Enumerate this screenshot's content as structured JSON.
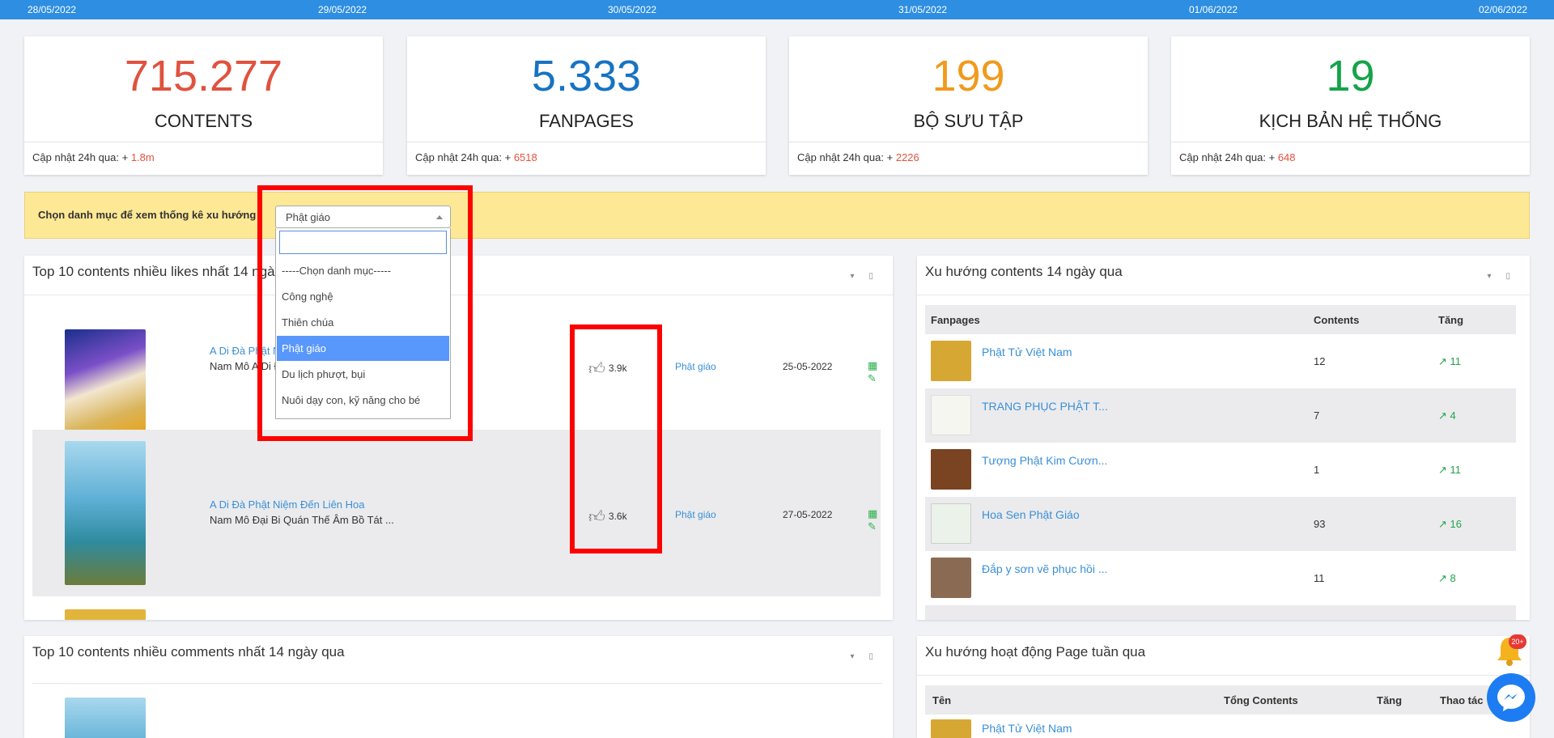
{
  "dates": [
    "28/05/2022",
    "29/05/2022",
    "30/05/2022",
    "31/05/2022",
    "01/06/2022",
    "02/06/2022"
  ],
  "stats": [
    {
      "value": "715.277",
      "label": "CONTENTS",
      "update_prefix": "Cập nhật 24h qua: +",
      "update_value": "1.8m",
      "color": "#e0523f"
    },
    {
      "value": "5.333",
      "label": "FANPAGES",
      "update_prefix": "Cập nhật 24h qua: +",
      "update_value": "6518",
      "color": "#1773c2"
    },
    {
      "value": "199",
      "label": "BỘ SƯU TẬP",
      "update_prefix": "Cập nhật 24h qua: +",
      "update_value": "2226",
      "color": "#f19a1c"
    },
    {
      "value": "19",
      "label": "KỊCH BẢN HỆ THỐNG",
      "update_prefix": "Cập nhật 24h qua: +",
      "update_value": "648",
      "color": "#16a34a"
    }
  ],
  "filter": {
    "label": "Chọn danh mục để xem thống kê xu hướng",
    "selected": "Phật giáo",
    "search_value": "",
    "options": [
      "-----Chọn danh mục-----",
      "Công nghệ",
      "Thiên chúa",
      "Phật giáo",
      "Du lịch phượt, bụi",
      "Nuôi dạy con, kỹ năng cho bé"
    ]
  },
  "top_likes": {
    "title": "Top 10 contents nhiều likes nhất 14 ngày qua",
    "rows": [
      {
        "title": "A Di Đà Phật Niệm Đến Liên Hoa",
        "desc": "Nam Mô A Di Đà Phật (Sư Huệ Duyên)",
        "likes": "3.9k",
        "category": "Phật giáo",
        "date": "25-05-2022"
      },
      {
        "title": "A Di Đà Phật Niệm Đến Liên Hoa",
        "desc": "Nam Mô Đại Bi Quán Thế Âm Bồ Tát ...",
        "likes": "3.6k",
        "category": "Phật giáo",
        "date": "27-05-2022"
      }
    ]
  },
  "trend": {
    "title": "Xu hướng contents 14 ngày qua",
    "headers": {
      "fanpages": "Fanpages",
      "contents": "Contents",
      "increase": "Tăng"
    },
    "rows": [
      {
        "name": "Phật Tử Việt Nam",
        "contents": "12",
        "increase": "11",
        "color": "#d7a733"
      },
      {
        "name": "TRANG PHỤC PHẬT T...",
        "contents": "7",
        "increase": "4",
        "color": "#f6f6f0"
      },
      {
        "name": "Tượng Phật Kim Cươn...",
        "contents": "1",
        "increase": "11",
        "color": "#7a4321"
      },
      {
        "name": "Hoa Sen Phật Giáo",
        "contents": "93",
        "increase": "16",
        "color": "#eaf2e9"
      },
      {
        "name": "Đắp y sơn vẽ phục hồi ...",
        "contents": "11",
        "increase": "8",
        "color": "#8a6a52"
      }
    ]
  },
  "top_comments": {
    "title": "Top 10 contents nhiều comments nhất 14 ngày qua"
  },
  "page_activity": {
    "title": "Xu hướng hoạt động Page tuần qua",
    "headers": {
      "name": "Tên",
      "total": "Tổng Contents",
      "increase": "Tăng",
      "actions": "Thao tác"
    },
    "first_row": "Phật Tử Việt Nam"
  },
  "notifications": {
    "badge": "20+"
  }
}
